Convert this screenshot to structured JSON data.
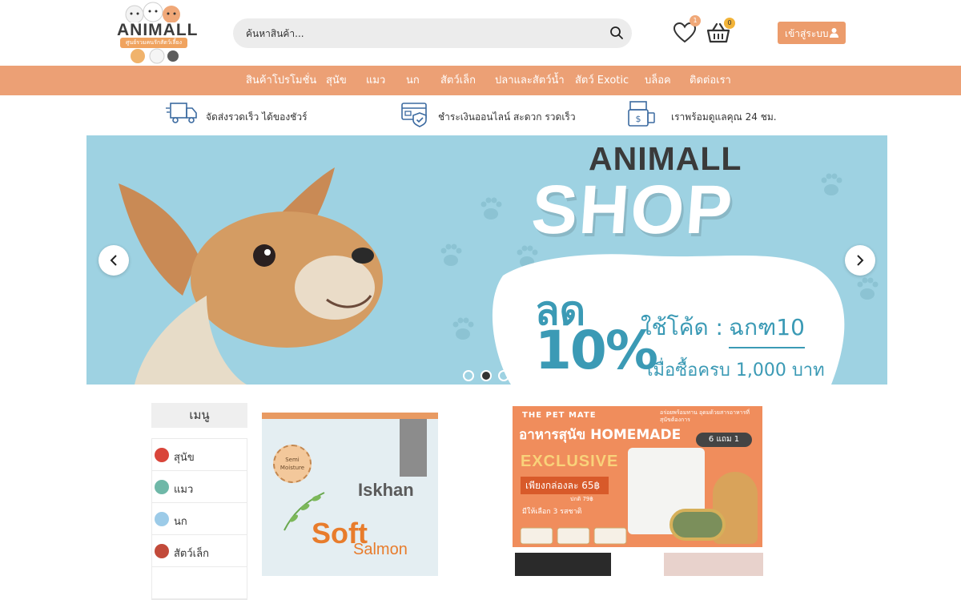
{
  "header": {
    "logo_text": "ANIMALL",
    "logo_tagline": "ศูนย์รวมคนรักสัตว์เลี้ยง",
    "search_placeholder": "ค้นหาสินค้า...",
    "wishlist_count": "1",
    "cart_count": "0",
    "login_label": "เข้าสู่ระบบ"
  },
  "nav": {
    "items": [
      "สินค้าโปรโมชั่น",
      "สุนัข",
      "แมว",
      "นก",
      "สัตว์เล็ก",
      "ปลาและสัตว์น้ำ",
      "สัตว์ Exotic",
      "บล็อค",
      "ติดต่อเรา"
    ]
  },
  "features": [
    {
      "icon": "delivery-truck-icon",
      "label": "จัดส่งรวดเร็ว ได้ของชัวร์"
    },
    {
      "icon": "secure-payment-icon",
      "label": "ชำระเงินออนไลน์ สะดวก รวดเร็ว"
    },
    {
      "icon": "cash-register-icon",
      "label": "เราพร้อมดูแลคุณ 24 ชม."
    }
  ],
  "banner": {
    "brand": "ANIMALL",
    "headline": "SHOP",
    "discount_word": "ลด",
    "discount_value": "10%",
    "code_label": "ใช้โค้ด :",
    "code": "ฉกฑ10",
    "condition": "เมื่อซื้อครบ 1,000 บาท",
    "active_slide": 2,
    "slide_count": 3
  },
  "sidebar": {
    "title": "เมนู",
    "items": [
      {
        "label": "สุนัข",
        "icon": "dog-icon",
        "color": "#d9453a"
      },
      {
        "label": "แมว",
        "icon": "cat-icon",
        "color": "#6fb8a8"
      },
      {
        "label": "นก",
        "icon": "bird-icon",
        "color": "#9ccbe8"
      },
      {
        "label": "สัตว์เล็ก",
        "icon": "small-animal-icon",
        "color": "#c24a3a"
      }
    ]
  },
  "product": {
    "brand": "Iskhan",
    "name_1": "Soft",
    "name_2": "Salmon",
    "tag": "Semi Moisture"
  },
  "promo": {
    "brand": "THE PET MATE",
    "title": "อาหารสุนัข HOMEMADE",
    "subtitle": "อร่อยพร้อมทาน อุดมด้วยสารอาหารที่สุนัขต้องการ",
    "offer": "6 แถม 1",
    "exclusive": "EXCLUSIVE",
    "price": "เพียงกล่องละ 65฿",
    "price_note": "ปกติ 79฿",
    "flavors": "มีให้เลือก 3 รสชาติ"
  },
  "colors": {
    "nav": "#eca075",
    "login": "#ec9c6c",
    "banner_bg": "#9ed2e2",
    "banner_text": "#3b9ab5"
  }
}
